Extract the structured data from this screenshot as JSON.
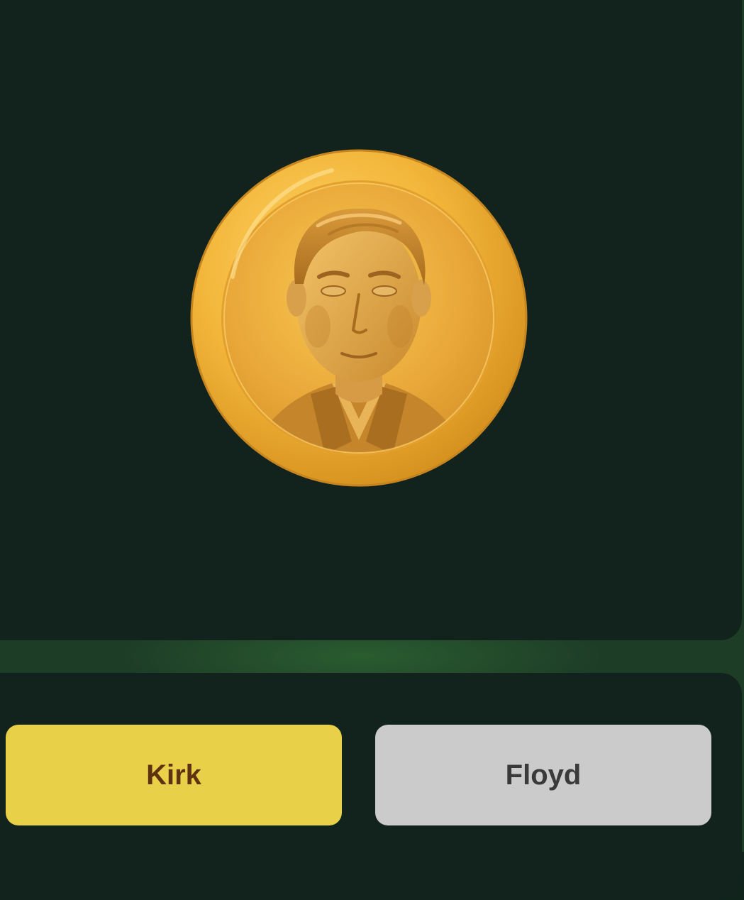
{
  "coin": {
    "icon": "gold-coin-portrait-icon"
  },
  "choices": [
    {
      "label": "Kirk",
      "background": "#e8d048",
      "color": "#5c3211",
      "state": "selected"
    },
    {
      "label": "Floyd",
      "background": "#cbcbcb",
      "color": "#3a3a3a",
      "state": "default"
    }
  ],
  "colors": {
    "background": "#11231c",
    "divider_glow": "#2e6a36",
    "coin_gold": "#f0b63a"
  }
}
